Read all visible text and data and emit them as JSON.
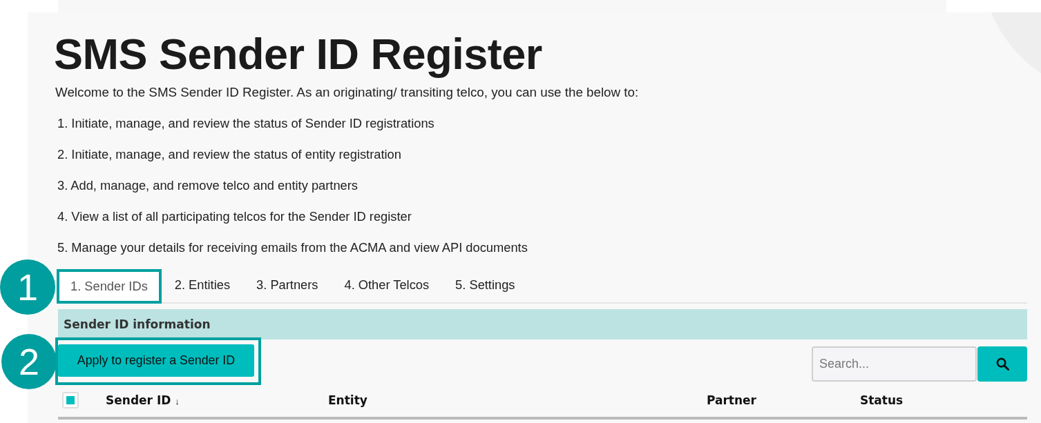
{
  "page": {
    "title": "SMS Sender ID Register",
    "intro": "Welcome to the SMS Sender ID Register. As an originating/ transiting telco, you can use the below to:",
    "steps": [
      "1. Initiate, manage, and review the status of Sender ID registrations",
      "2. Initiate, manage, and review the status of entity registration",
      "3. Add, manage, and remove telco and entity partners",
      "4. View a list of all participating telcos for the Sender ID register",
      "5. Manage your details for receiving emails from the ACMA and view API documents"
    ]
  },
  "tabs": [
    {
      "label": "1. Sender IDs",
      "selected": true,
      "callout": "1"
    },
    {
      "label": "2. Entities",
      "selected": false
    },
    {
      "label": "3. Partners",
      "selected": false
    },
    {
      "label": "4. Other Telcos",
      "selected": false
    },
    {
      "label": "5. Settings",
      "selected": false
    }
  ],
  "section": {
    "title": "Sender ID information"
  },
  "apply_button": {
    "label": "Apply to register a Sender ID",
    "callout": "2"
  },
  "search": {
    "placeholder": "Search..."
  },
  "table": {
    "select_all": {
      "checked": true
    },
    "columns": [
      {
        "label": "Sender ID",
        "sort_mark": "↓"
      },
      {
        "label": "Entity"
      },
      {
        "label": "Partner"
      },
      {
        "label": "Status"
      }
    ]
  }
}
